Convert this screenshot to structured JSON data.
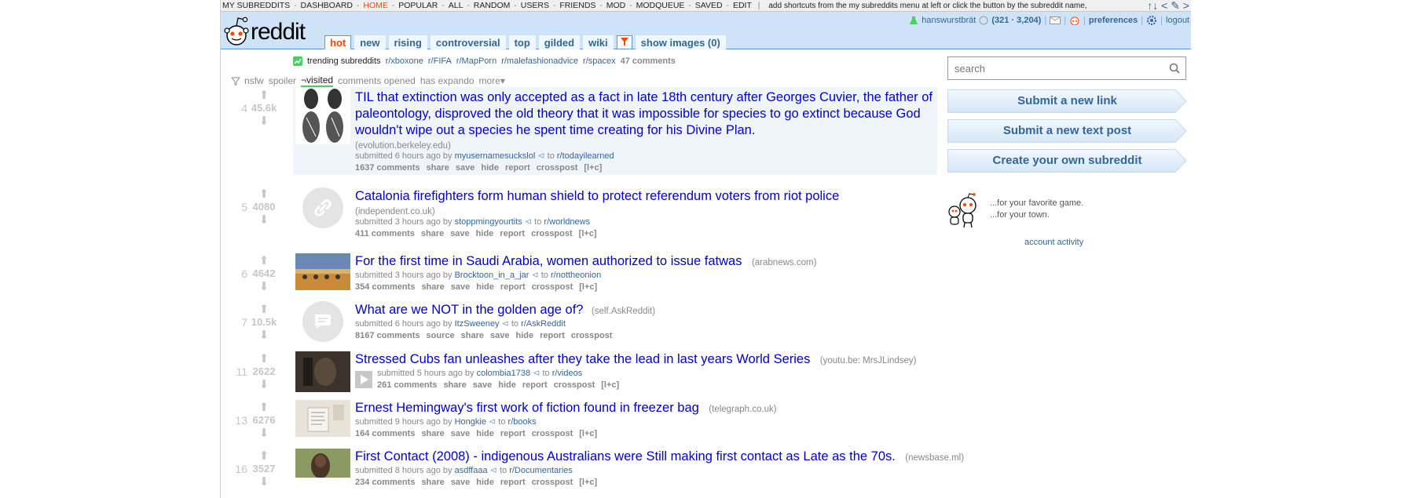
{
  "srbar": {
    "items": [
      "MY SUBREDDITS",
      "DASHBOARD",
      "HOME",
      "POPULAR",
      "ALL",
      "RANDOM",
      "USERS",
      "FRIENDS",
      "MOD",
      "MODQUEUE",
      "SAVED",
      "EDIT"
    ],
    "hint": "add shortcuts from the my subreddits menu at left or click the button by the subreddit name,",
    "arrows": "↑↓ < ✎ >"
  },
  "header": {
    "logo_text": "reddit",
    "tabs": [
      "hot",
      "new",
      "rising",
      "controversial",
      "top",
      "gilded",
      "wiki"
    ],
    "show_images": "show images (0)",
    "user": {
      "name": "hanswurstbrät",
      "karma": "(321 · 3,204)",
      "preferences": "preferences",
      "logout": "logout"
    }
  },
  "trending": {
    "label": "trending subreddits",
    "subreddits": [
      "r/xboxone",
      "r/FIFA",
      "r/MapPorn",
      "r/malefashionadvice",
      "r/spacex"
    ],
    "comments": "47 comments"
  },
  "filters": {
    "nsfw": "nsfw",
    "spoiler": "spoiler",
    "visited": "¬visited",
    "comments_opened": "comments opened",
    "has_expando": "has expando",
    "more": "more▾"
  },
  "posts": [
    {
      "rank": "4",
      "score": "45.6k",
      "title": "TIL that extinction was only accepted as a fact in late 18th century after Georges Cuvier, the father of paleontology, disproved the old theory that it was impossible for species to go extinct because God wouldn't wipe out a species he spent time creating for his Divine Plan.",
      "domain": "(evolution.berkeley.edu)",
      "submitted": "submitted 6 hours ago by",
      "author": "myusernamesuckslol",
      "to": "to",
      "subreddit": "r/todayilearned",
      "buttons": [
        "1637 comments",
        "share",
        "save",
        "hide",
        "report",
        "crosspost",
        "[l+c]"
      ]
    },
    {
      "rank": "5",
      "score": "4080",
      "title": "Catalonia firefighters form human shield to protect referendum voters from riot police",
      "domain": "(independent.co.uk)",
      "submitted": "submitted 3 hours ago by",
      "author": "stoppmingyourtits",
      "to": "to",
      "subreddit": "r/worldnews",
      "buttons": [
        "411 comments",
        "share",
        "save",
        "hide",
        "report",
        "crosspost",
        "[l+c]"
      ]
    },
    {
      "rank": "6",
      "score": "4642",
      "title": "For the first time in Saudi Arabia, women authorized to issue fatwas",
      "domain": "(arabnews.com)",
      "submitted": "submitted 3 hours ago by",
      "author": "Brocktoon_in_a_jar",
      "to": "to",
      "subreddit": "r/nottheonion",
      "buttons": [
        "354 comments",
        "share",
        "save",
        "hide",
        "report",
        "crosspost",
        "[l+c]"
      ]
    },
    {
      "rank": "7",
      "score": "10.5k",
      "title": "What are we NOT in the golden age of?",
      "domain": "(self.AskReddit)",
      "submitted": "submitted 6 hours ago by",
      "author": "ItzSweeney",
      "to": "to",
      "subreddit": "r/AskReddit",
      "buttons": [
        "8167 comments",
        "source",
        "share",
        "save",
        "hide",
        "report",
        "crosspost"
      ]
    },
    {
      "rank": "11",
      "score": "2622",
      "title": "Stressed Cubs fan unleashes after they take the lead in last years World Series",
      "domain": "(youtu.be: MrsJLindsey)",
      "submitted": "submitted 5 hours ago by",
      "author": "colombia1738",
      "to": "to",
      "subreddit": "r/videos",
      "buttons": [
        "261 comments",
        "share",
        "save",
        "hide",
        "report",
        "crosspost",
        "[l+c]"
      ]
    },
    {
      "rank": "13",
      "score": "6276",
      "title": "Ernest Hemingway's first work of fiction found in freezer bag",
      "domain": "(telegraph.co.uk)",
      "submitted": "submitted 9 hours ago by",
      "author": "Hongkie",
      "to": "to",
      "subreddit": "r/books",
      "buttons": [
        "164 comments",
        "share",
        "save",
        "hide",
        "report",
        "crosspost",
        "[l+c]"
      ]
    },
    {
      "rank": "16",
      "score": "3527",
      "title": "First Contact (2008) - indigenous Australians were Still making first contact as Late as the 70s.",
      "domain": "(newsbase.ml)",
      "submitted": "submitted 8 hours ago by",
      "author": "asdffaaa",
      "to": "to",
      "subreddit": "r/Documentaries",
      "buttons": [
        "234 comments",
        "share",
        "save",
        "hide",
        "report",
        "crosspost",
        "[l+c]"
      ]
    }
  ],
  "sidebar": {
    "search_placeholder": "search",
    "submit_link": "Submit a new link",
    "submit_text": "Submit a new text post",
    "create_sub": "Create your own subreddit",
    "tag1": "...for your favorite game.",
    "tag2": "...for your town.",
    "account_activity": "account activity"
  },
  "colors": {
    "header_bg": "#cee3f8",
    "link": "#336699",
    "title": "#0000cc",
    "accent": "#ff4500"
  }
}
